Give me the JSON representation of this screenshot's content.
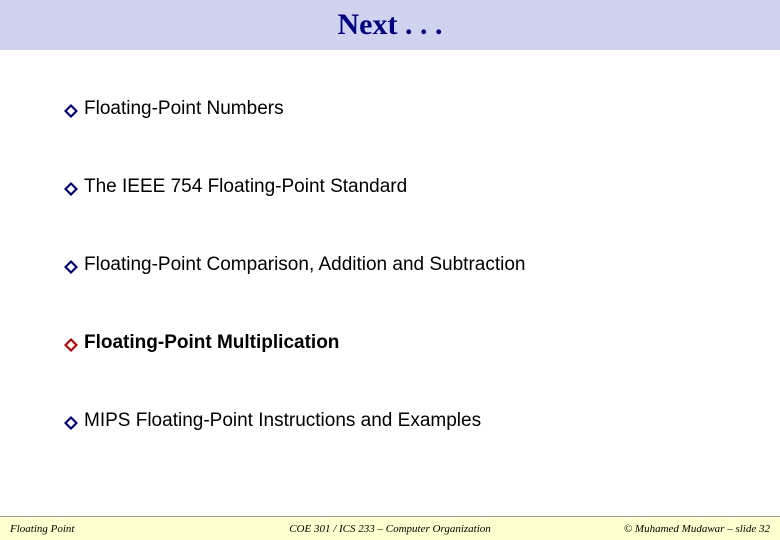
{
  "title": "Next . . .",
  "bullets": [
    {
      "text": "Floating-Point Numbers",
      "highlight": false
    },
    {
      "text": "The IEEE 754 Floating-Point Standard",
      "highlight": false
    },
    {
      "text": "Floating-Point Comparison, Addition and Subtraction",
      "highlight": false
    },
    {
      "text": "Floating-Point Multiplication",
      "highlight": true
    },
    {
      "text": "MIPS Floating-Point Instructions and Examples",
      "highlight": false
    }
  ],
  "footer": {
    "left": "Floating Point",
    "center": "COE 301 / ICS 233 – Computer Organization",
    "right": "© Muhamed Mudawar – slide 32"
  }
}
